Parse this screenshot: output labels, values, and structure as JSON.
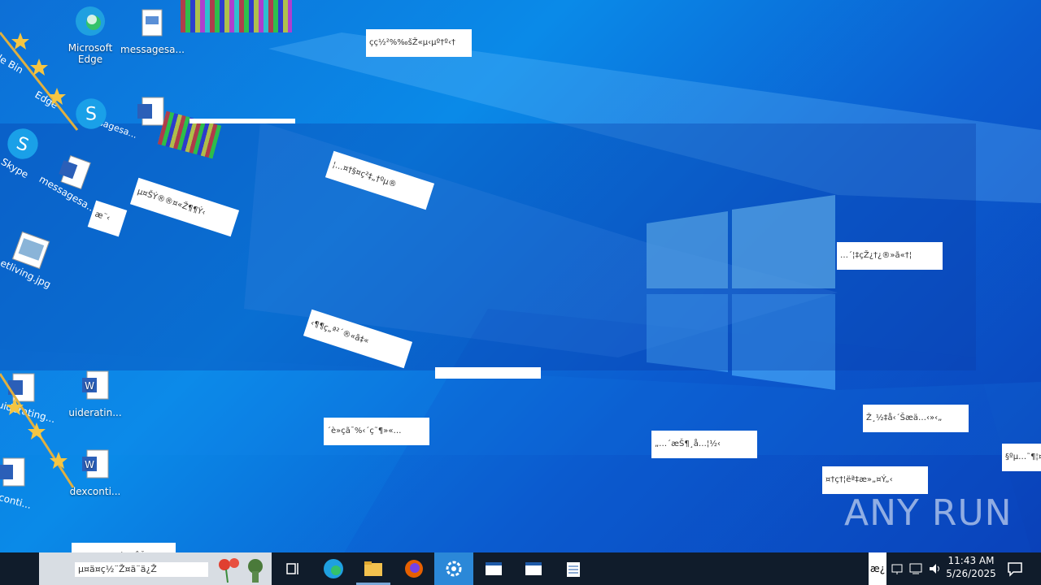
{
  "desktop": {
    "icons": [
      {
        "label": "Microsoft\nEdge",
        "icon": "edge-icon"
      },
      {
        "label": "messagesa...",
        "icon": "printer-doc-icon"
      },
      {
        "label": "uideratin...",
        "icon": "word-doc-icon"
      },
      {
        "label": "dexconti...",
        "icon": "word-doc-icon"
      }
    ],
    "ghost_labels": [
      "le Bin",
      "Edge",
      "messagesa...",
      "Skype",
      "messagesa...",
      "etliving.jpg",
      "uiderating...",
      "conti..."
    ]
  },
  "garbled_labels": [
    "çç½²%‰šŽ«µ‹µº†º‹†",
    "¦…¤†§¤ç²‡„†ºµ®",
    "µ¤ŠÝ®®¤«Ž¶¶Ý‹",
    "æ¨‹",
    "…´¦‡çŽ¿†¿®»ã«†¦",
    "‹¶¶ç„ª²´®«ã‡«",
    "´è»çã¯%‹´ç˜¶»«…",
    "„…´æŠ¶¸å…¦½‹",
    "Ž¸½‡å‹´Šæä…‹»‹„",
    "¤†ç†¦ëª‡æ»„¤Ý„‹",
    "§ºµ…˜¶¦¤",
    "ç‹æ«æ¿æ‹´ç‡‹åŽ"
  ],
  "taskbar": {
    "buttons": [
      "task-view-icon",
      "edge-icon",
      "file-explorer-icon",
      "firefox-icon",
      "settings-icon",
      "window-icon",
      "window-icon",
      "notepad-icon"
    ],
    "search_text": "µ¤ä¤ç½¨Ž¤ä¨ä¿Ž",
    "lang": "æ¿",
    "clock_time": "11:43 AM",
    "clock_date": "5/26/2025"
  },
  "watermark": "ANY RUN",
  "colors": {
    "accent": "#0b78e3",
    "taskbar": "#101c2b",
    "active": "#2b88d8"
  }
}
